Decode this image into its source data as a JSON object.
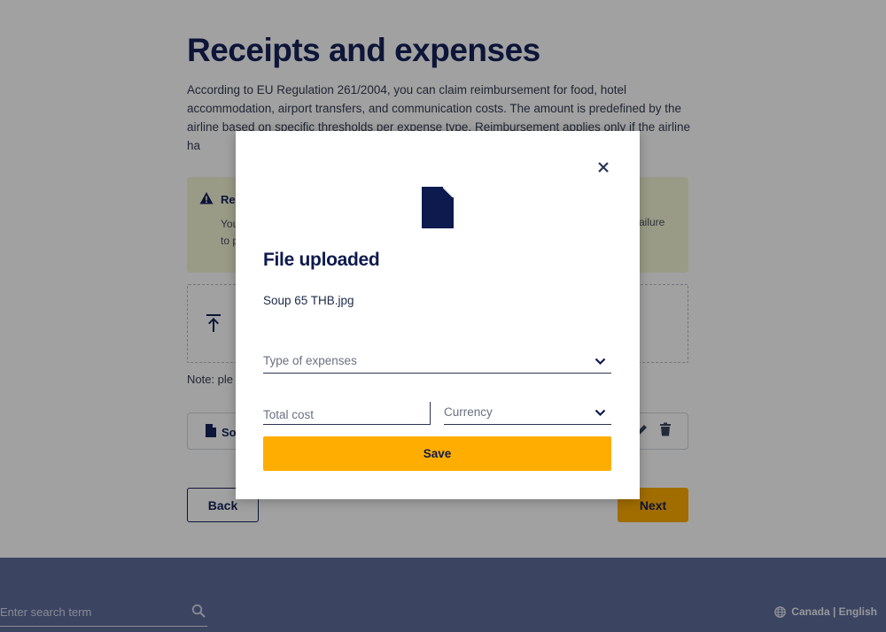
{
  "page": {
    "title": "Receipts and expenses",
    "intro": "According to EU Regulation 261/2004, you can claim reimbursement for food, hotel accommodation, airport transfers, and communication costs. The amount is predefined by the airline based on specific thresholds per expense type. Reimbursement applies only if the airline ha",
    "warning_title": "Re",
    "warning_text_left": "You",
    "warning_text_left_2": "to p",
    "warning_text_right": "ailure",
    "note": "Note: ple",
    "file_row_name": "So",
    "back_label": "Back",
    "next_label": "Next"
  },
  "footer": {
    "search_placeholder": "Enter search term",
    "locale": "Canada | English"
  },
  "modal": {
    "title": "File uploaded",
    "filename": "Soup 65 THB.jpg",
    "type_label": "Type of expenses",
    "cost_placeholder": "Total cost",
    "currency_label": "Currency",
    "save_label": "Save"
  },
  "colors": {
    "accent": "#ffad00",
    "navy": "#15225a",
    "footer": "#5e6c9a",
    "warning_bg": "#f3f5d6"
  },
  "icons": [
    "warning-icon",
    "upload-icon",
    "file-icon",
    "edit-icon",
    "trash-icon",
    "search-icon",
    "globe-icon",
    "close-icon",
    "chevron-down-icon"
  ]
}
